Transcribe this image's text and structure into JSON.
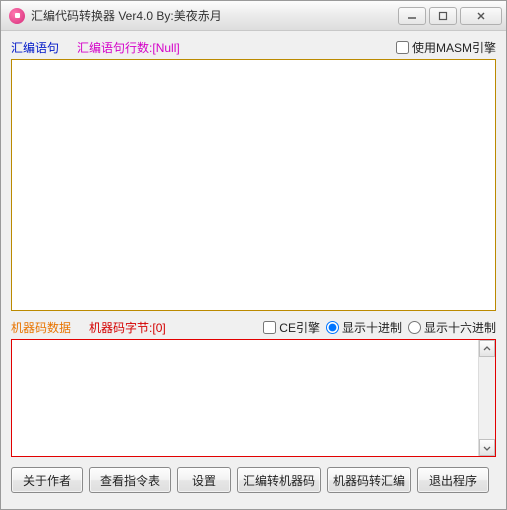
{
  "window": {
    "title": "汇编代码转换器 Ver4.0  By:美夜赤月"
  },
  "asm": {
    "label": "汇编语句",
    "lines_label": "汇编语句行数:",
    "lines_value": "[Null]",
    "use_masm_label": "使用MASM引擎",
    "use_masm_checked": false,
    "content": ""
  },
  "mc": {
    "label": "机器码数据",
    "bytes_label": "机器码字节:",
    "bytes_value": "[0]",
    "ce_engine_label": "CE引擎",
    "ce_engine_checked": false,
    "radix_dec_label": "显示十进制",
    "radix_hex_label": "显示十六进制",
    "radix_selected": "dec",
    "content": ""
  },
  "buttons": {
    "about": "关于作者",
    "opcodes": "查看指令表",
    "settings": "设置",
    "asm2mc": "汇编转机器码",
    "mc2asm": "机器码转汇编",
    "exit": "退出程序"
  }
}
